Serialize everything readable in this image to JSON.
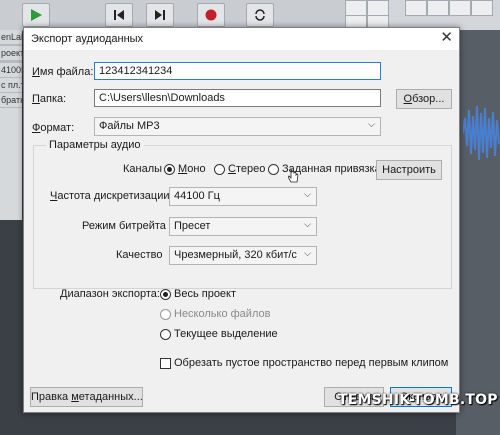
{
  "background": {
    "left_panel_lines": [
      "enLab",
      "",
      "роект",
      "",
      "",
      "4100Г",
      "с пл.т",
      "братн"
    ]
  },
  "dialog": {
    "title": "Экспорт аудиоданных",
    "file_name": {
      "label_u": "И",
      "label_rest": "мя файла:",
      "value": "123412341234"
    },
    "folder": {
      "label_u": "П",
      "label_rest": "апка:",
      "value": "C:\\Users\\llesn\\Downloads",
      "browse_u": "О",
      "browse_rest": "бзор..."
    },
    "format": {
      "label_u": "Ф",
      "label_rest": "ормат:",
      "value": "Файлы MP3"
    },
    "audio_params": {
      "legend": "Параметры аудио",
      "channels_label": "Каналы",
      "channels": [
        {
          "u": "М",
          "rest": "оно",
          "selected": true
        },
        {
          "u": "С",
          "rest": "терео",
          "selected": false
        },
        {
          "u": "",
          "rest": "Заданная привязка",
          "selected": false
        }
      ],
      "configure": "Настроить",
      "sample_rate_label_u": "Ч",
      "sample_rate_label_rest": "астота дискретизации:",
      "sample_rate": "44100 Гц",
      "bitrate_mode_label": "Режим битрейта",
      "bitrate_mode": "Пресет",
      "quality_label": "Качество",
      "quality": "Чрезмерный, 320 кбит/с"
    },
    "export_range": {
      "label": "Диапазон экспорта:",
      "options": [
        {
          "text": "Весь проект",
          "selected": true,
          "disabled": false
        },
        {
          "text": "Несколько файлов",
          "selected": false,
          "disabled": true
        },
        {
          "text": "Текущее выделение",
          "selected": false,
          "disabled": false
        }
      ]
    },
    "trim_checkbox": "Обрезать пустое пространство перед первым клипом",
    "metadata_button_u": "Правка ",
    "metadata_button_mid": "м",
    "metadata_button_rest": "етаданных...",
    "cancel_button": "Отмена",
    "export_button": "Экспорт"
  },
  "watermark": "TEMSHIK-TOMB.TOP"
}
